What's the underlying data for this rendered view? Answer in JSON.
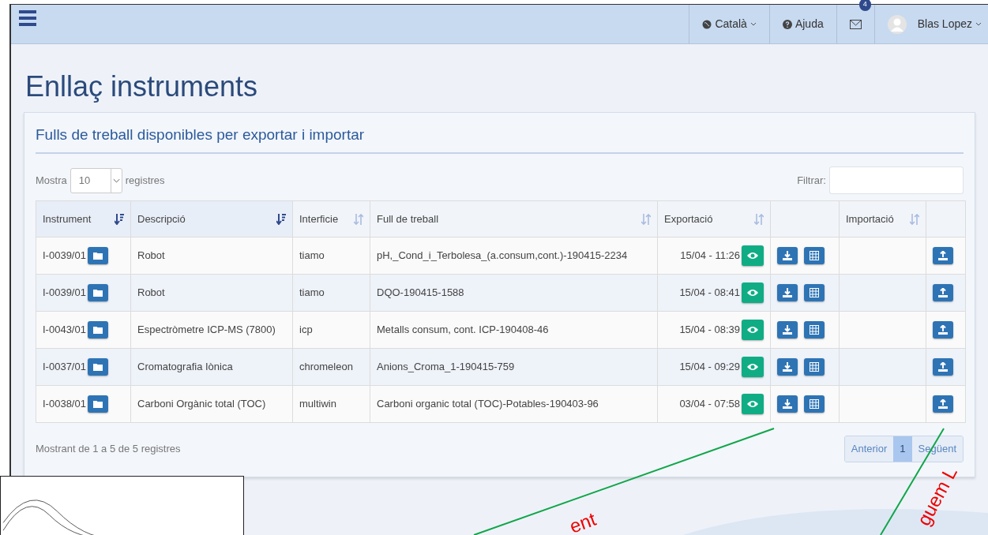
{
  "navbar": {
    "language": "Català",
    "help": "Ajuda",
    "mail_badge": "4",
    "user": "Blas Lopez"
  },
  "page_title": "Enllaç instruments",
  "card": {
    "title": "Fulls de treball disponibles per exportar i importar",
    "length": {
      "label_before": "Mostra",
      "value": "10",
      "label_after": "registres"
    },
    "filter": {
      "label": "Filtrar:"
    },
    "columns": [
      {
        "label": "Instrument",
        "sortable": true,
        "sorted": true
      },
      {
        "label": "Descripció",
        "sortable": true,
        "sorted": true
      },
      {
        "label": "Interficie",
        "sortable": true,
        "sorted": false
      },
      {
        "label": "Full de treball",
        "sortable": true,
        "sorted": false
      },
      {
        "label": "Exportació",
        "sortable": true,
        "sorted": false
      },
      {
        "sortable": false
      },
      {
        "label": "Importació",
        "sortable": true,
        "sorted": false
      },
      {
        "sortable": false
      }
    ],
    "rows": [
      {
        "instrument": "I-0039/01",
        "description": "Robot",
        "interface": "tiamo",
        "worksheet": "pH,_Cond_i_Terbolesa_(a.consum,cont.)-190415-2234",
        "export": "15/04 - 11:26"
      },
      {
        "instrument": "I-0039/01",
        "description": "Robot",
        "interface": "tiamo",
        "worksheet": "DQO-190415-1588",
        "export": "15/04 - 08:41"
      },
      {
        "instrument": "I-0043/01",
        "description": "Espectròmetre ICP-MS (7800)",
        "interface": "icp",
        "worksheet": "Metalls consum, cont. ICP-190408-46",
        "export": "15/04 - 08:39"
      },
      {
        "instrument": "I-0037/01",
        "description": "Cromatografia Iònica",
        "interface": "chromeleon",
        "worksheet": "Anions_Croma_1-190415-759",
        "export": "15/04 - 09:29"
      },
      {
        "instrument": "I-0038/01",
        "description": "Carboni Orgànic total (TOC)",
        "interface": "multiwin",
        "worksheet": "Carboni organic total (TOC)-Potables-190403-96",
        "export": "03/04 - 07:58"
      }
    ],
    "info": "Mostrant de 1 a 5 de 5 registres",
    "pagination": [
      {
        "label": "Anterior",
        "selected": false
      },
      {
        "label": "1",
        "selected": true
      },
      {
        "label": "Següent",
        "selected": false
      }
    ]
  },
  "annotations": [
    {
      "text": "ent"
    },
    {
      "text": "guem L"
    }
  ]
}
